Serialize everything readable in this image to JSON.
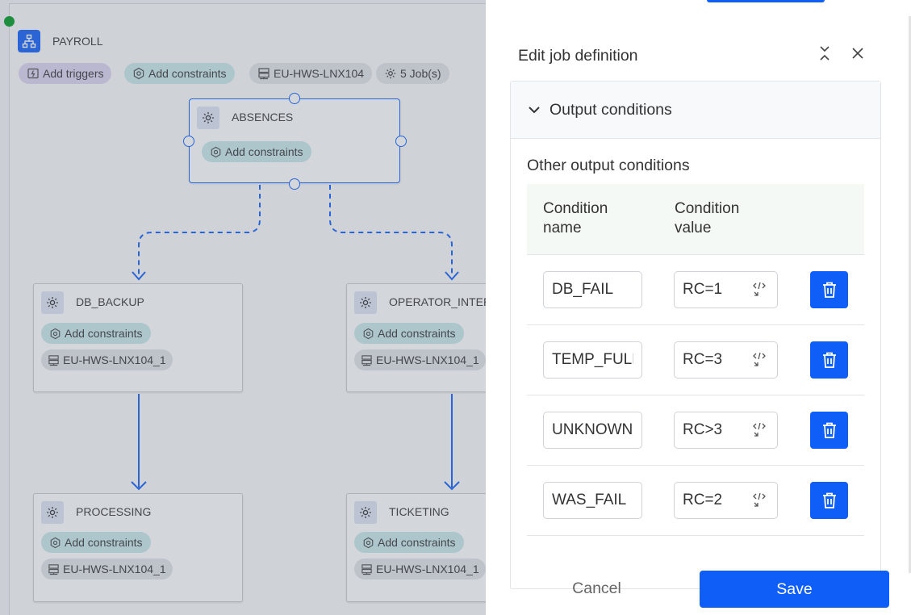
{
  "workflow": {
    "title": "PAYROLL",
    "chips": {
      "triggers": "Add triggers",
      "constraints": "Add constraints",
      "host": "EU-HWS-LNX104",
      "jobs": "5 Job(s)"
    }
  },
  "jobs": [
    {
      "name": "ABSENCES",
      "constraints": "Add constraints"
    },
    {
      "name": "DB_BACKUP",
      "constraints": "Add constraints",
      "host": "EU-HWS-LNX104_1"
    },
    {
      "name": "OPERATOR_INTER",
      "constraints": "Add constraints",
      "host": "EU-HWS-LNX104_1"
    },
    {
      "name": "PROCESSING",
      "constraints": "Add constraints",
      "host": "EU-HWS-LNX104_1"
    },
    {
      "name": "TICKETING",
      "constraints": "Add constraints",
      "host": "EU-HWS-LNX104_1"
    }
  ],
  "panel": {
    "title": "Edit job definition",
    "section_title": "Output conditions",
    "subsection_title": "Other output conditions",
    "columns": [
      "Condition name",
      "Condition value"
    ],
    "conditions": [
      {
        "name": "DB_FAIL",
        "value": "RC=1"
      },
      {
        "name": "TEMP_FULL",
        "value": "RC=3"
      },
      {
        "name": "UNKNOWN",
        "value": "RC>3"
      },
      {
        "name": "WAS_FAIL",
        "value": "RC=2"
      }
    ],
    "cancel_label": "Cancel",
    "save_label": "Save"
  },
  "colors": {
    "accent": "#0f5ef7",
    "status": "#1e8e3e"
  }
}
